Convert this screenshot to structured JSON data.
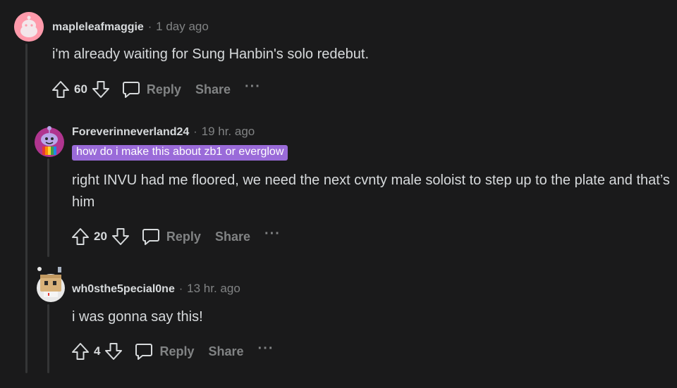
{
  "comments": [
    {
      "username": "mapleleafmaggie",
      "separator": "·",
      "time": "1 day ago",
      "body": "i'm already waiting for Sung Hanbin's solo redebut.",
      "votes": "60",
      "reply_label": "Reply",
      "share_label": "Share",
      "more_label": "···",
      "avatar_color": "#ff99aa"
    },
    {
      "username": "Foreverinneverland24",
      "separator": "·",
      "time": "19 hr. ago",
      "flair": "how do i make this about zb1 or everglow",
      "body": "right INVU had me floored, we need the next cvnty male soloist to step up to the plate and that’s him",
      "votes": "20",
      "reply_label": "Reply",
      "share_label": "Share",
      "more_label": "···",
      "flair_color": "#9a6bd9"
    },
    {
      "username": "wh0sthe5pecial0ne",
      "separator": "·",
      "time": "13 hr. ago",
      "body": "i was gonna say this!",
      "votes": "4",
      "reply_label": "Reply",
      "share_label": "Share",
      "more_label": "···"
    }
  ],
  "icons": {
    "upvote": "arrow-up-icon",
    "downvote": "arrow-down-icon",
    "reply": "speech-bubble-icon",
    "more": "ellipsis-icon"
  }
}
